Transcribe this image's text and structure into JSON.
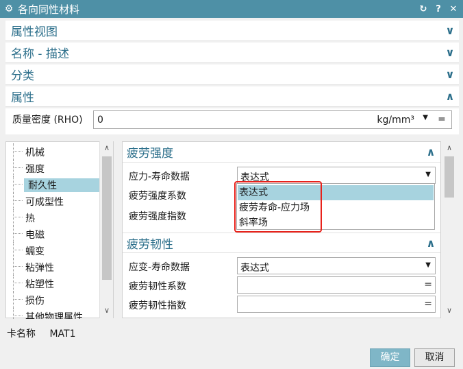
{
  "window": {
    "title": "各向同性材料",
    "icons": {
      "reset": "↻",
      "help": "?",
      "close": "✕"
    }
  },
  "sections": {
    "property_view": "属性视图",
    "name_desc": "名称 - 描述",
    "category": "分类",
    "properties": "属性"
  },
  "density": {
    "label": "质量密度 (RHO)",
    "value": "0",
    "unit": "kg/mm³",
    "eq": "="
  },
  "tree": {
    "items": [
      {
        "label": "机械"
      },
      {
        "label": "强度"
      },
      {
        "label": "耐久性",
        "selected": true
      },
      {
        "label": "可成型性"
      },
      {
        "label": "热"
      },
      {
        "label": "电磁"
      },
      {
        "label": "蠕变"
      },
      {
        "label": "粘弹性"
      },
      {
        "label": "粘塑性"
      },
      {
        "label": "损伤"
      },
      {
        "label": "其他物理属性"
      }
    ]
  },
  "fatigue_strength": {
    "header": "疲劳强度",
    "stress_life_label": "应力-寿命数据",
    "stress_life_value": "表达式",
    "coef_label": "疲劳强度系数",
    "exp_label": "疲劳强度指数",
    "dropdown_options": [
      "表达式",
      "疲劳寿命-应力场",
      "斜率场"
    ]
  },
  "fatigue_toughness": {
    "header": "疲劳韧性",
    "strain_life_label": "应变-寿命数据",
    "strain_life_value": "表达式",
    "coef_label": "疲劳韧性系数",
    "exp_label": "疲劳韧性指数",
    "eq": "="
  },
  "card": {
    "label": "卡名称",
    "value": "MAT1"
  },
  "buttons": {
    "ok": "确定",
    "cancel": "取消"
  },
  "colors": {
    "accent": "#4e90a6",
    "header_text": "#2c6f8b",
    "selection": "#a7d3df",
    "highlight": "#e8221b"
  }
}
